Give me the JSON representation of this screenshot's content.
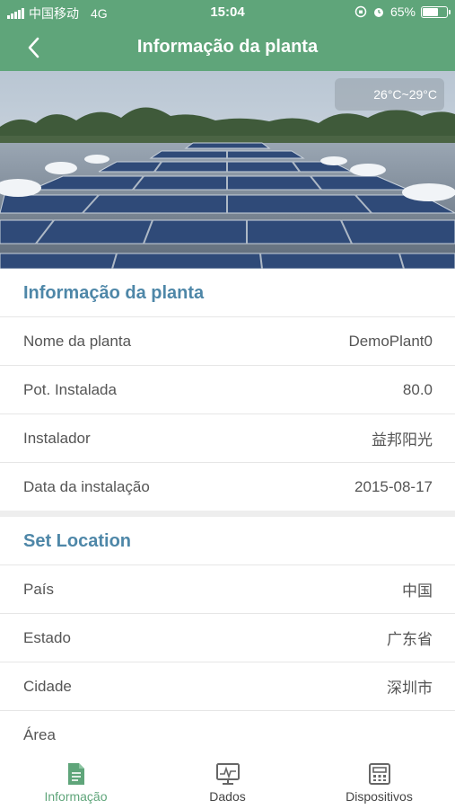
{
  "status_bar": {
    "carrier": "中国移动",
    "network": "4G",
    "time": "15:04",
    "battery": "65%",
    "battery_level": 0.65
  },
  "nav": {
    "title": "Informação da planta",
    "back_icon": "chevron-left-icon"
  },
  "hero": {
    "temperature": "26°C~29°C"
  },
  "plant_info": {
    "header": "Informação da planta",
    "rows": [
      {
        "label": "Nome da planta",
        "value": "DemoPlant0"
      },
      {
        "label": "Pot. Instalada",
        "value": "80.0"
      },
      {
        "label": "Instalador",
        "value": "益邦阳光"
      },
      {
        "label": "Data da instalação",
        "value": "2015-08-17"
      }
    ]
  },
  "location": {
    "header": "Set Location",
    "rows": [
      {
        "label": "País",
        "value": "中国"
      },
      {
        "label": "Estado",
        "value": "广东省"
      },
      {
        "label": "Cidade",
        "value": "深圳市"
      },
      {
        "label": "Área",
        "value": ""
      }
    ]
  },
  "tabs": [
    {
      "label": "Informação",
      "icon": "document-icon",
      "active": true
    },
    {
      "label": "Dados",
      "icon": "monitor-chart-icon",
      "active": false
    },
    {
      "label": "Dispositivos",
      "icon": "device-icon",
      "active": false
    }
  ],
  "colors": {
    "brand_green": "#5fa57a",
    "section_blue": "#4e87a8"
  }
}
